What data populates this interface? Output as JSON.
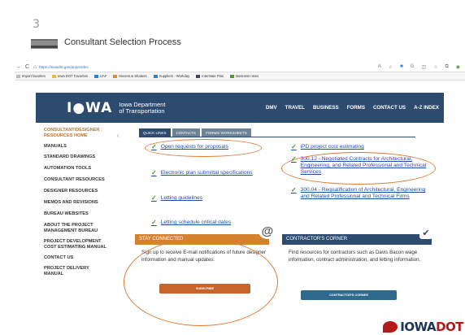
{
  "slide": {
    "number": "3",
    "title": "Consultant Selection Process"
  },
  "browser": {
    "url": "https://iowadot.gov/projectdev",
    "favorites": [
      "Import favorites",
      "Iowa DOT Favorites",
      "UAF",
      "Movers & Shakers",
      "Suppliers - Workday",
      "Interstate Plan",
      "Business news"
    ]
  },
  "site": {
    "logo": "I●WA",
    "dept_line1": "Iowa Department",
    "dept_line2": "of Transportation",
    "nav": [
      "DMV",
      "TRAVEL",
      "BUSINESS",
      "FORMS",
      "CONTACT US",
      "A-Z INDEX"
    ]
  },
  "left_nav": [
    "CONSULTANT/DESIGNER RESOURCES HOME",
    "MANUALS",
    "STANDARD DRAWINGS",
    "AUTOMATION TOOLS",
    "CONSULTANT RESOURCES",
    "DESIGNER RESOURCES",
    "MEMOS AND REVISIONS",
    "BUREAU WEBSITES",
    "ABOUT THE PROJECT MANAGEMENT BUREAU",
    "PROJECT DEVELOPMENT COST ESTIMATING MANUAL",
    "CONTACT US",
    "PROJECT DELIVERY MANUAL"
  ],
  "tabs": [
    "QUICK LINKS",
    "CONTACTS",
    "FORMS/ WORKSHEETS"
  ],
  "links": {
    "open_requests": "Open requests for proposals",
    "electronic_plan": "Electronic plan submittal specifications",
    "letting_guidelines": "Letting guidelines",
    "letting_schedule": "Letting schedule critical dates",
    "ipd": "iPD project cost estimating",
    "negotiated": "300.12 - Negotiated Contracts for Architectural, Engineering, and Related Professional and Technical Services",
    "requalification": "300.04 - Requalification of Architectural, Engineering and Related Professional and Technical Firms"
  },
  "stay_connected": {
    "heading": "STAY CONNECTED",
    "body": "Sign up to receive E-mail notifications of future designer information and manual updates.",
    "button": "SUBSCRIBE",
    "icon": "@"
  },
  "contractors_corner": {
    "heading": "CONTRACTOR'S CORNER",
    "body": "Find resources for contractors such as Davis Bacon wage information, contract administration, and letting information.",
    "button": "CONTRACTOR'S CORNER"
  },
  "footer_logo": {
    "text": "IOWA",
    "text2": "DOT"
  },
  "colors": {
    "dot_blue": "#2d4b6e",
    "orange": "#d4822e",
    "highlight": "#e07b34",
    "link": "#1f4fa3"
  }
}
